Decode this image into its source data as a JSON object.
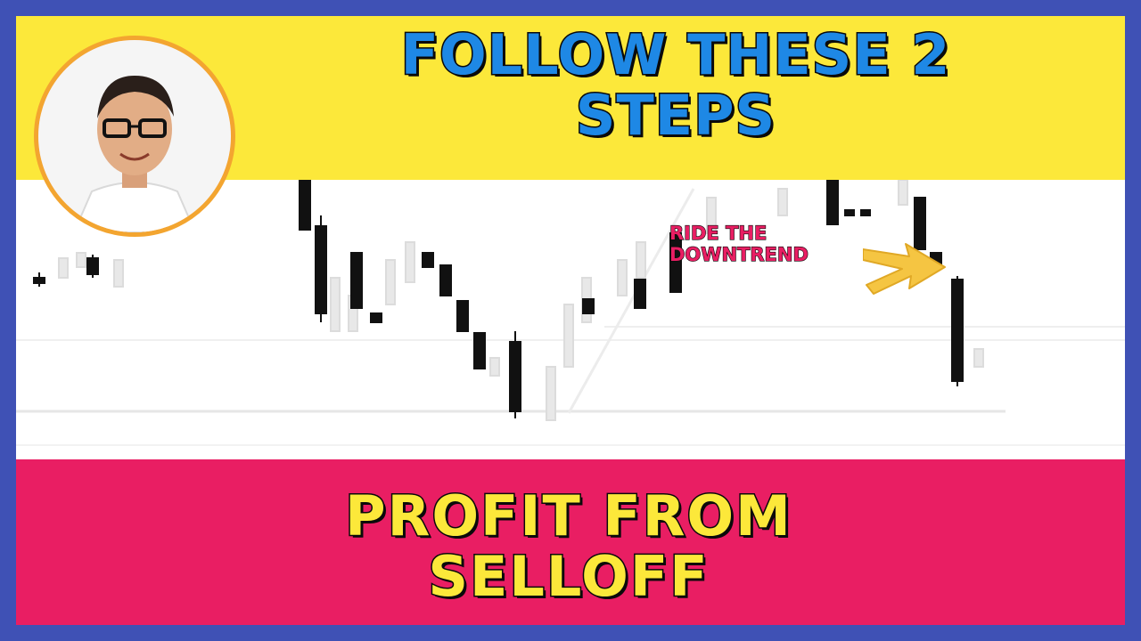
{
  "headline": {
    "line1": "FOLLOW THESE 2",
    "line2": "STEPS"
  },
  "subhead": {
    "line1": "PROFIT FROM",
    "line2": "SELLOFF"
  },
  "annotation": {
    "line1": "RIDE THE",
    "line2": "DOWNTREND",
    "color": "#e91e63",
    "arrow_color": "#f5c542",
    "arrow_icon": "arrow-pointing-right-down"
  },
  "colors": {
    "frame": "#3f51b5",
    "top_band": "#fce83a",
    "bottom_band": "#e91e63",
    "headline_text": "#1e88e5",
    "subhead_text": "#fce83a",
    "bearish_candle": "#111111",
    "faded_candle": "#e6e6e6"
  },
  "avatar": {
    "description_icon": "presenter-portrait"
  }
}
